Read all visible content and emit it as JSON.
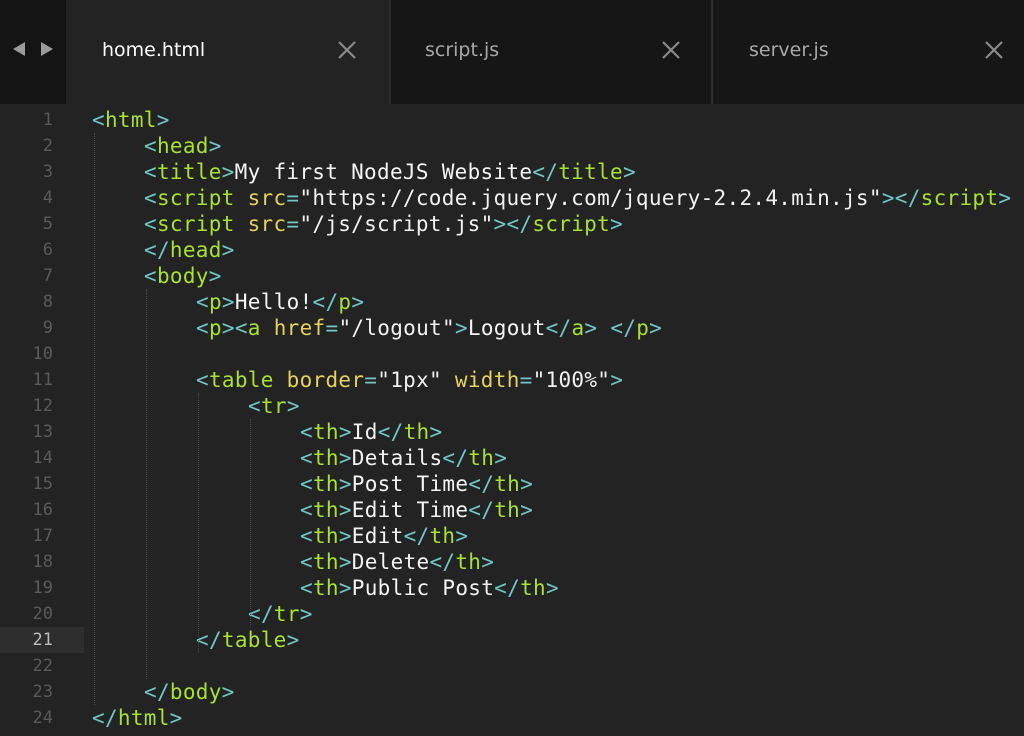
{
  "nav": {
    "back_icon": "arrow-left-icon",
    "forward_icon": "arrow-right-icon"
  },
  "tabs": [
    {
      "label": "home.html",
      "active": true,
      "close_icon": "close-icon"
    },
    {
      "label": "script.js",
      "active": false,
      "close_icon": "close-icon"
    },
    {
      "label": "server.js",
      "active": false,
      "close_icon": "close-icon"
    }
  ],
  "editor": {
    "current_line": 21,
    "colors": {
      "background": "#232323",
      "punctuation": "#6fc7c7",
      "tag": "#a6e22e",
      "attribute": "#e6d15a",
      "text": "#f4f4f4"
    },
    "lines": [
      {
        "n": "1",
        "indent": 0,
        "tokens": [
          [
            "p",
            "<"
          ],
          [
            "t",
            "html"
          ],
          [
            "p",
            ">"
          ]
        ]
      },
      {
        "n": "2",
        "indent": 1,
        "tokens": [
          [
            "p",
            "<"
          ],
          [
            "t",
            "head"
          ],
          [
            "p",
            ">"
          ]
        ]
      },
      {
        "n": "3",
        "indent": 1,
        "tokens": [
          [
            "p",
            "<"
          ],
          [
            "t",
            "title"
          ],
          [
            "p",
            ">"
          ],
          [
            "x",
            "My first NodeJS Website"
          ],
          [
            "p",
            "</"
          ],
          [
            "t",
            "title"
          ],
          [
            "p",
            ">"
          ]
        ]
      },
      {
        "n": "4",
        "indent": 1,
        "tokens": [
          [
            "p",
            "<"
          ],
          [
            "t",
            "script"
          ],
          [
            "x",
            " "
          ],
          [
            "a",
            "src"
          ],
          [
            "p",
            "="
          ],
          [
            "s",
            "\"https://code.jquery.com/jquery-2.2.4.min.js\""
          ],
          [
            "p",
            "></"
          ],
          [
            "t",
            "script"
          ],
          [
            "p",
            ">"
          ]
        ]
      },
      {
        "n": "5",
        "indent": 1,
        "tokens": [
          [
            "p",
            "<"
          ],
          [
            "t",
            "script"
          ],
          [
            "x",
            " "
          ],
          [
            "a",
            "src"
          ],
          [
            "p",
            "="
          ],
          [
            "s",
            "\"/js/script.js\""
          ],
          [
            "p",
            "></"
          ],
          [
            "t",
            "script"
          ],
          [
            "p",
            ">"
          ]
        ]
      },
      {
        "n": "6",
        "indent": 1,
        "tokens": [
          [
            "p",
            "</"
          ],
          [
            "t",
            "head"
          ],
          [
            "p",
            ">"
          ]
        ]
      },
      {
        "n": "7",
        "indent": 1,
        "tokens": [
          [
            "p",
            "<"
          ],
          [
            "t",
            "body"
          ],
          [
            "p",
            ">"
          ]
        ]
      },
      {
        "n": "8",
        "indent": 2,
        "tokens": [
          [
            "p",
            "<"
          ],
          [
            "t",
            "p"
          ],
          [
            "p",
            ">"
          ],
          [
            "x",
            "Hello!"
          ],
          [
            "p",
            "</"
          ],
          [
            "t",
            "p"
          ],
          [
            "p",
            ">"
          ]
        ]
      },
      {
        "n": "9",
        "indent": 2,
        "tokens": [
          [
            "p",
            "<"
          ],
          [
            "t",
            "p"
          ],
          [
            "p",
            "><"
          ],
          [
            "t",
            "a"
          ],
          [
            "x",
            " "
          ],
          [
            "a",
            "href"
          ],
          [
            "p",
            "="
          ],
          [
            "s",
            "\"/logout\""
          ],
          [
            "p",
            ">"
          ],
          [
            "x",
            "Logout"
          ],
          [
            "p",
            "</"
          ],
          [
            "t",
            "a"
          ],
          [
            "p",
            ">"
          ],
          [
            "x",
            " "
          ],
          [
            "p",
            "</"
          ],
          [
            "t",
            "p"
          ],
          [
            "p",
            ">"
          ]
        ]
      },
      {
        "n": "10",
        "indent": 0,
        "tokens": []
      },
      {
        "n": "11",
        "indent": 2,
        "tokens": [
          [
            "p",
            "<"
          ],
          [
            "t",
            "table"
          ],
          [
            "x",
            " "
          ],
          [
            "a",
            "border"
          ],
          [
            "p",
            "="
          ],
          [
            "s",
            "\"1px\""
          ],
          [
            "x",
            " "
          ],
          [
            "a",
            "width"
          ],
          [
            "p",
            "="
          ],
          [
            "s",
            "\"100%\""
          ],
          [
            "p",
            ">"
          ]
        ]
      },
      {
        "n": "12",
        "indent": 3,
        "tokens": [
          [
            "p",
            "<"
          ],
          [
            "t",
            "tr"
          ],
          [
            "p",
            ">"
          ]
        ]
      },
      {
        "n": "13",
        "indent": 4,
        "tokens": [
          [
            "p",
            "<"
          ],
          [
            "t",
            "th"
          ],
          [
            "p",
            ">"
          ],
          [
            "x",
            "Id"
          ],
          [
            "p",
            "</"
          ],
          [
            "t",
            "th"
          ],
          [
            "p",
            ">"
          ]
        ]
      },
      {
        "n": "14",
        "indent": 4,
        "tokens": [
          [
            "p",
            "<"
          ],
          [
            "t",
            "th"
          ],
          [
            "p",
            ">"
          ],
          [
            "x",
            "Details"
          ],
          [
            "p",
            "</"
          ],
          [
            "t",
            "th"
          ],
          [
            "p",
            ">"
          ]
        ]
      },
      {
        "n": "15",
        "indent": 4,
        "tokens": [
          [
            "p",
            "<"
          ],
          [
            "t",
            "th"
          ],
          [
            "p",
            ">"
          ],
          [
            "x",
            "Post Time"
          ],
          [
            "p",
            "</"
          ],
          [
            "t",
            "th"
          ],
          [
            "p",
            ">"
          ]
        ]
      },
      {
        "n": "16",
        "indent": 4,
        "tokens": [
          [
            "p",
            "<"
          ],
          [
            "t",
            "th"
          ],
          [
            "p",
            ">"
          ],
          [
            "x",
            "Edit Time"
          ],
          [
            "p",
            "</"
          ],
          [
            "t",
            "th"
          ],
          [
            "p",
            ">"
          ]
        ]
      },
      {
        "n": "17",
        "indent": 4,
        "tokens": [
          [
            "p",
            "<"
          ],
          [
            "t",
            "th"
          ],
          [
            "p",
            ">"
          ],
          [
            "x",
            "Edit"
          ],
          [
            "p",
            "</"
          ],
          [
            "t",
            "th"
          ],
          [
            "p",
            ">"
          ]
        ]
      },
      {
        "n": "18",
        "indent": 4,
        "tokens": [
          [
            "p",
            "<"
          ],
          [
            "t",
            "th"
          ],
          [
            "p",
            ">"
          ],
          [
            "x",
            "Delete"
          ],
          [
            "p",
            "</"
          ],
          [
            "t",
            "th"
          ],
          [
            "p",
            ">"
          ]
        ]
      },
      {
        "n": "19",
        "indent": 4,
        "tokens": [
          [
            "p",
            "<"
          ],
          [
            "t",
            "th"
          ],
          [
            "p",
            ">"
          ],
          [
            "x",
            "Public Post"
          ],
          [
            "p",
            "</"
          ],
          [
            "t",
            "th"
          ],
          [
            "p",
            ">"
          ]
        ]
      },
      {
        "n": "20",
        "indent": 3,
        "tokens": [
          [
            "p",
            "</"
          ],
          [
            "t",
            "tr"
          ],
          [
            "p",
            ">"
          ]
        ]
      },
      {
        "n": "21",
        "indent": 2,
        "tokens": [
          [
            "p",
            "</"
          ],
          [
            "t",
            "table"
          ],
          [
            "p",
            ">"
          ]
        ]
      },
      {
        "n": "22",
        "indent": 0,
        "tokens": []
      },
      {
        "n": "23",
        "indent": 1,
        "tokens": [
          [
            "p",
            "</"
          ],
          [
            "t",
            "body"
          ],
          [
            "p",
            ">"
          ]
        ]
      },
      {
        "n": "24",
        "indent": 0,
        "tokens": [
          [
            "p",
            "</"
          ],
          [
            "t",
            "html"
          ],
          [
            "p",
            ">"
          ]
        ]
      }
    ]
  }
}
